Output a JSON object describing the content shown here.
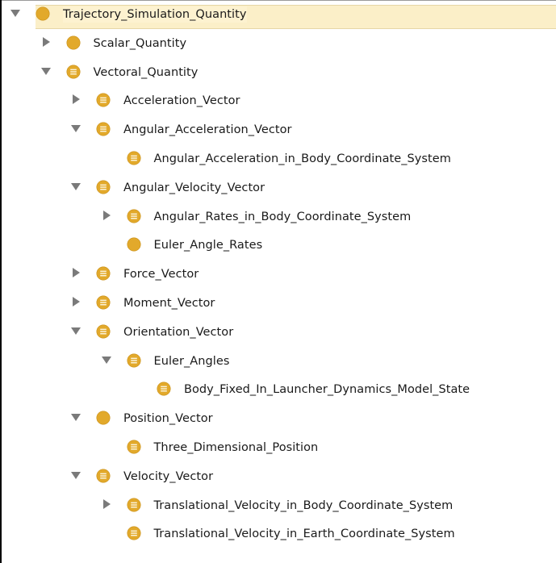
{
  "colors": {
    "class_icon": "#e2a92b",
    "class_icon_stroke": "#c98f17",
    "defined_line": "#fbf3da",
    "toggle": "#7a7a7a",
    "selection": "#fbefc8",
    "text": "#1a1a1a"
  },
  "tree": {
    "nodes": [
      {
        "label": "Trajectory_Simulation_Quantity",
        "depth": 0,
        "toggle": "expanded",
        "icon": "class-icon",
        "selected": true
      },
      {
        "label": "Scalar_Quantity",
        "depth": 1,
        "toggle": "collapsed",
        "icon": "class-icon"
      },
      {
        "label": "Vectoral_Quantity",
        "depth": 1,
        "toggle": "expanded",
        "icon": "defined-class-icon"
      },
      {
        "label": "Acceleration_Vector",
        "depth": 2,
        "toggle": "collapsed",
        "icon": "defined-class-icon"
      },
      {
        "label": "Angular_Acceleration_Vector",
        "depth": 2,
        "toggle": "expanded",
        "icon": "defined-class-icon"
      },
      {
        "label": "Angular_Acceleration_in_Body_Coordinate_System",
        "depth": 3,
        "toggle": "none",
        "icon": "defined-class-icon"
      },
      {
        "label": "Angular_Velocity_Vector",
        "depth": 2,
        "toggle": "expanded",
        "icon": "defined-class-icon"
      },
      {
        "label": "Angular_Rates_in_Body_Coordinate_System",
        "depth": 3,
        "toggle": "collapsed",
        "icon": "defined-class-icon"
      },
      {
        "label": "Euler_Angle_Rates",
        "depth": 3,
        "toggle": "none",
        "icon": "class-icon"
      },
      {
        "label": "Force_Vector",
        "depth": 2,
        "toggle": "collapsed",
        "icon": "defined-class-icon"
      },
      {
        "label": "Moment_Vector",
        "depth": 2,
        "toggle": "collapsed",
        "icon": "defined-class-icon"
      },
      {
        "label": "Orientation_Vector",
        "depth": 2,
        "toggle": "expanded",
        "icon": "defined-class-icon"
      },
      {
        "label": "Euler_Angles",
        "depth": 3,
        "toggle": "expanded",
        "icon": "defined-class-icon"
      },
      {
        "label": "Body_Fixed_In_Launcher_Dynamics_Model_State",
        "depth": 4,
        "toggle": "none",
        "icon": "defined-class-icon"
      },
      {
        "label": "Position_Vector",
        "depth": 2,
        "toggle": "expanded",
        "icon": "class-icon"
      },
      {
        "label": "Three_Dimensional_Position",
        "depth": 3,
        "toggle": "none",
        "icon": "defined-class-icon"
      },
      {
        "label": "Velocity_Vector",
        "depth": 2,
        "toggle": "expanded",
        "icon": "defined-class-icon"
      },
      {
        "label": "Translational_Velocity_in_Body_Coordinate_System",
        "depth": 3,
        "toggle": "collapsed",
        "icon": "defined-class-icon"
      },
      {
        "label": "Translational_Velocity_in_Earth_Coordinate_System",
        "depth": 3,
        "toggle": "none",
        "icon": "defined-class-icon"
      }
    ]
  }
}
